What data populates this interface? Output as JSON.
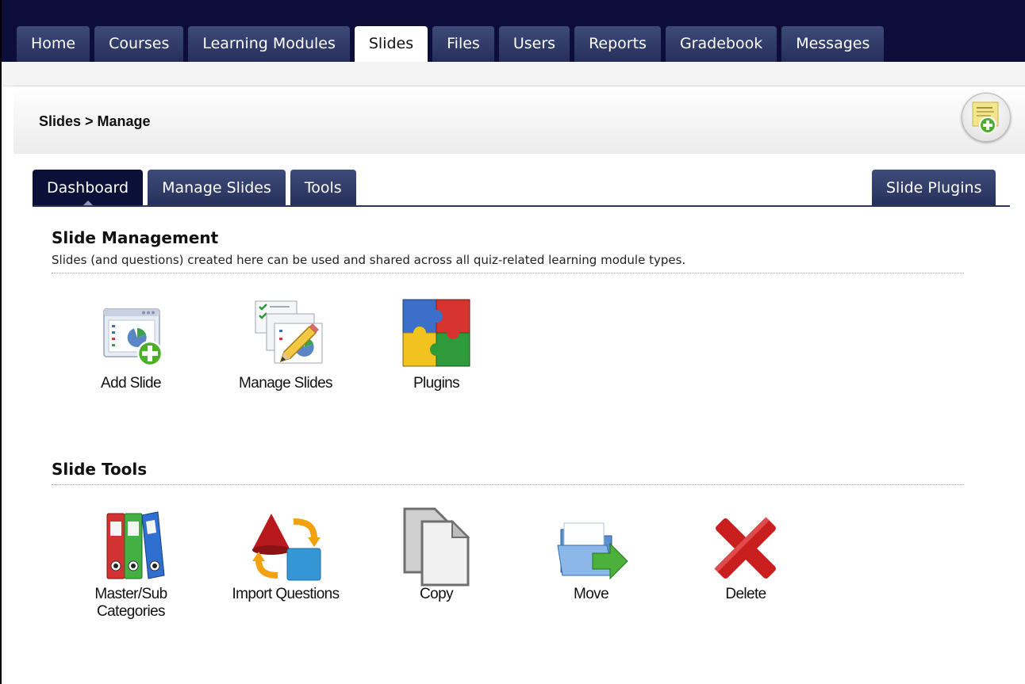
{
  "top_nav": {
    "tabs": [
      {
        "label": "Home"
      },
      {
        "label": "Courses"
      },
      {
        "label": "Learning Modules"
      },
      {
        "label": "Slides"
      },
      {
        "label": "Files"
      },
      {
        "label": "Users"
      },
      {
        "label": "Reports"
      },
      {
        "label": "Gradebook"
      },
      {
        "label": "Messages"
      }
    ],
    "active": "Slides"
  },
  "header": {
    "breadcrumb": "Slides > Manage",
    "add_note_icon": "sticky-note-add-icon"
  },
  "subtabs": {
    "left": [
      {
        "label": "Dashboard"
      },
      {
        "label": "Manage Slides"
      },
      {
        "label": "Tools"
      }
    ],
    "right": [
      {
        "label": "Slide Plugins"
      }
    ],
    "active": "Dashboard"
  },
  "management": {
    "title": "Slide Management",
    "description": "Slides (and questions) created here can be used and shared across all quiz-related learning module types.",
    "items": [
      {
        "label": "Add Slide",
        "icon": "add-slide-icon"
      },
      {
        "label": "Manage Slides",
        "icon": "manage-slides-icon"
      },
      {
        "label": "Plugins",
        "icon": "puzzle-plugins-icon"
      }
    ]
  },
  "tools": {
    "title": "Slide Tools",
    "items": [
      {
        "label": "Master/Sub Categories",
        "line1": "Master/Sub",
        "line2": "Categories",
        "icon": "binders-icon"
      },
      {
        "label": "Import Questions",
        "icon": "import-shapes-icon"
      },
      {
        "label": "Copy",
        "icon": "copy-icon"
      },
      {
        "label": "Move",
        "icon": "move-folder-icon"
      },
      {
        "label": "Delete",
        "icon": "delete-x-icon"
      }
    ]
  },
  "colors": {
    "nav_dark": "#0d0d3a",
    "tab_blue": "#2e3868",
    "active_subtab": "#0b1038",
    "plus_green": "#4caf2a",
    "delete_red": "#c81e1e"
  }
}
